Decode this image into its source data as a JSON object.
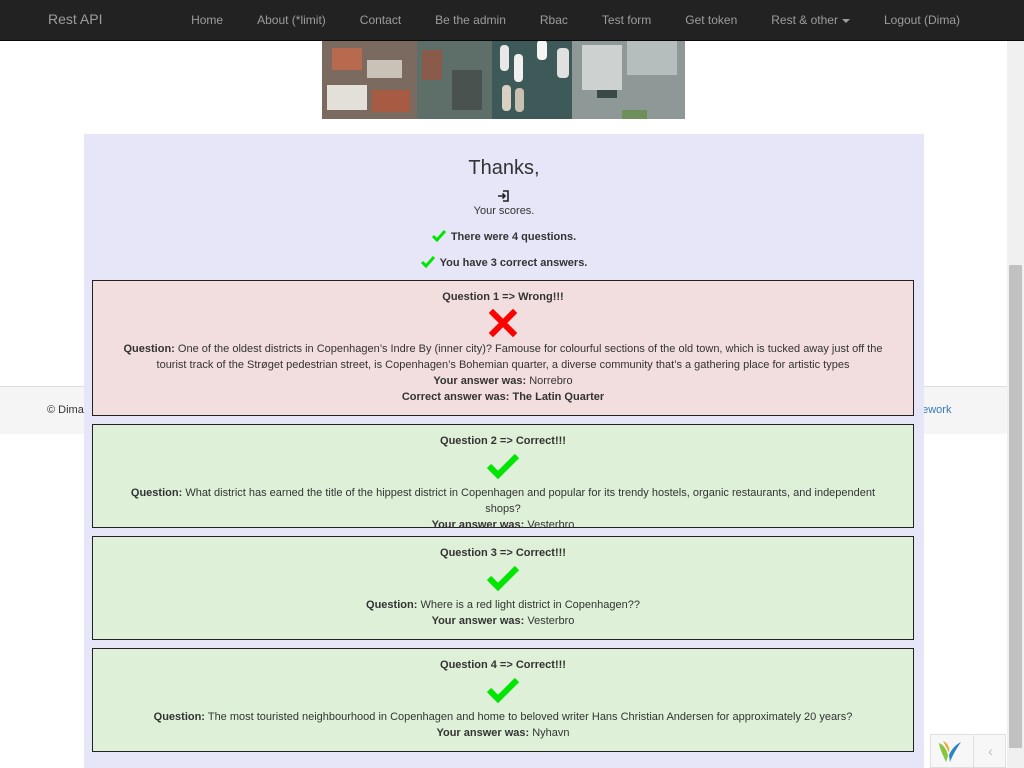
{
  "navbar": {
    "brand": "Rest API",
    "links": [
      "Home",
      "About (*limit)",
      "Contact",
      "Be the admin",
      "Rbac",
      "Test form",
      "Get token",
      "Rest & other",
      "Logout (Dima)"
    ]
  },
  "footer": {
    "left": "© Dima",
    "right": "nework"
  },
  "results": {
    "title": "Thanks,",
    "subtitle": "Your scores.",
    "questions_count_text": "There were 4 questions.",
    "correct_count_text": "You have 3 correct answers."
  },
  "labels": {
    "question": "Question:",
    "your_answer": "Your answer was:",
    "correct_answer": "Correct answer was:"
  },
  "questions": [
    {
      "title": "Question 1 => Wrong!!!",
      "status": "wrong",
      "question": "One of the oldest districts in Copenhagen’s Indre By (inner city)? Famouse for colourful sections of the old town, which is tucked away just off the tourist track of the Strøget pedestrian street, is Copenhagen’s Bohemian quarter, a diverse community that’s a gathering place for artistic types",
      "your_answer": "Norrebro",
      "correct_answer": "The Latin Quarter"
    },
    {
      "title": "Question 2 => Correct!!!",
      "status": "correct",
      "question": "What district has earned the title of the hippest district in Copenhagen and popular for its trendy hostels, organic restaurants, and independent shops?",
      "your_answer": "Vesterbro"
    },
    {
      "title": "Question 3 => Correct!!!",
      "status": "correct",
      "question": "Where is a red light district in Copenhagen??",
      "your_answer": "Vesterbro"
    },
    {
      "title": "Question 4 => Correct!!!",
      "status": "correct",
      "question": "The most touristed neighbourhood in Copenhagen and home to beloved writer Hans Christian Andersen for approximately 20 years?",
      "your_answer": "Nyhavn"
    }
  ],
  "colors": {
    "navbar_bg": "#222222",
    "panel_bg": "#e6e6f8",
    "wrong_bg": "#f2dede",
    "correct_bg": "#dff0d8",
    "check_green": "#00e600",
    "cross_red": "#ff0000"
  },
  "icons": {
    "correct": "checkmark-icon",
    "wrong": "cross-icon",
    "enter": "sign-in-icon"
  }
}
